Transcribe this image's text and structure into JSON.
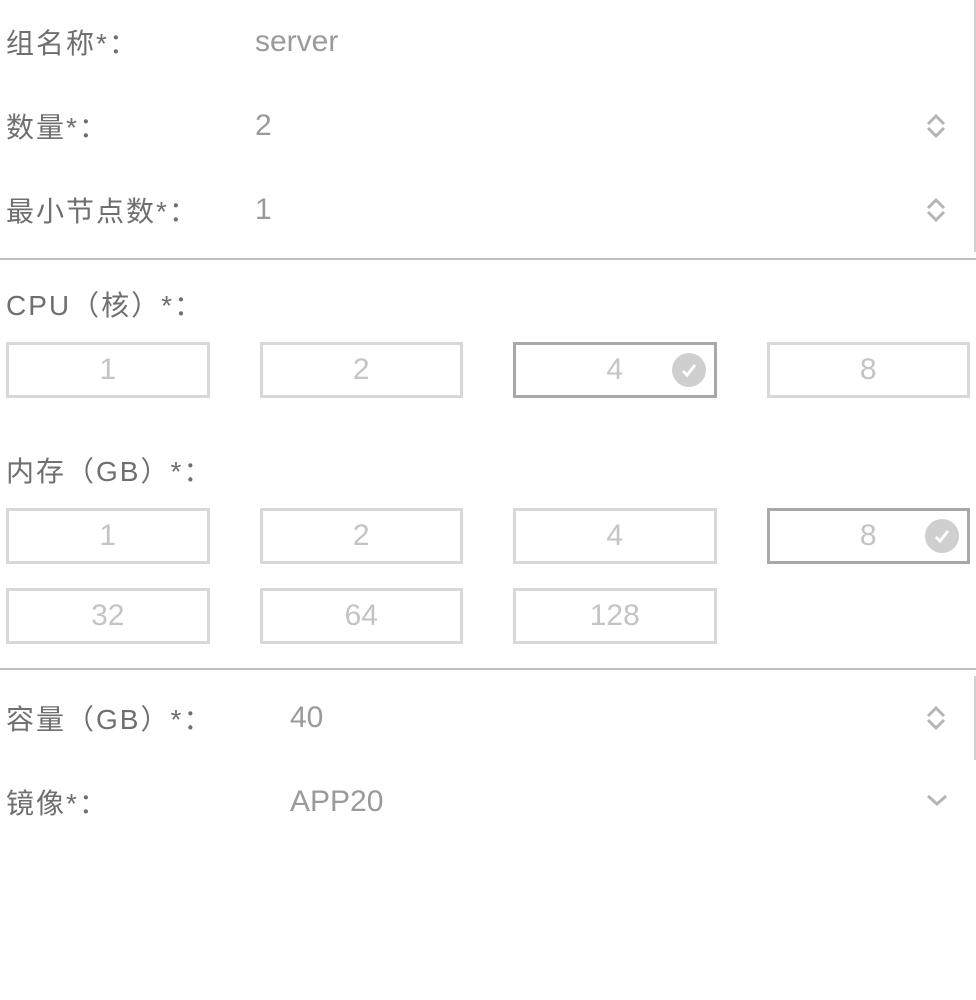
{
  "group_name": {
    "label": "组名称*：",
    "value": "server"
  },
  "quantity": {
    "label": "数量*：",
    "value": "2"
  },
  "min_nodes": {
    "label": "最小节点数*：",
    "value": "1"
  },
  "cpu": {
    "label": "CPU（核）*：",
    "options": [
      "1",
      "2",
      "4",
      "8"
    ],
    "selected": "4"
  },
  "memory": {
    "label": "内存（GB）*：",
    "options": [
      "1",
      "2",
      "4",
      "8",
      "32",
      "64",
      "128"
    ],
    "selected": "8"
  },
  "capacity": {
    "label": "容量（GB）*：",
    "value": "40"
  },
  "image": {
    "label": "镜像*：",
    "value": "APP20"
  }
}
